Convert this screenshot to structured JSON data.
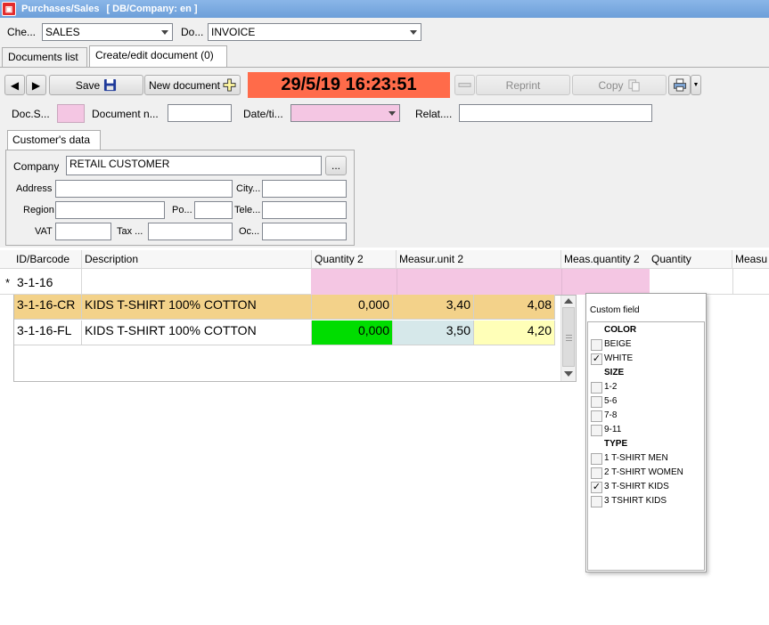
{
  "titlebar": {
    "app_title": "Purchases/Sales",
    "db_info": "[ DB/Company: en ]"
  },
  "top": {
    "che_label": "Che...",
    "che_value": "SALES",
    "do_label": "Do...",
    "do_value": "INVOICE"
  },
  "tabs": {
    "documents_list": "Documents list",
    "create_edit": "Create/edit document (0)"
  },
  "toolbar": {
    "save_label": "Save",
    "new_document_label": "New document",
    "datetime": "29/5/19 16:23:51",
    "reprint_label": "Reprint",
    "copy_label": "Copy",
    "datetime_bg": "#ff6b4a"
  },
  "docfields": {
    "doc_s_label": "Doc.S...",
    "document_n_label": "Document n...",
    "date_label": "Date/ti...",
    "relat_label": "Relat...."
  },
  "customer": {
    "tab_label": "Customer's data",
    "company_label": "Company",
    "company_value": "RETAIL CUSTOMER",
    "browse_label": "...",
    "address_label": "Address",
    "city_label": "City...",
    "region_label": "Region",
    "po_label": "Po...",
    "tele_label": "Tele...",
    "vat_label": "VAT",
    "tax_label": "Tax ...",
    "oc_label": "Oc..."
  },
  "grid": {
    "columns": [
      "ID/Barcode",
      "Description",
      "Quantity 2",
      "Measur.unit 2",
      "Meas.quantity 2",
      "Quantity",
      "Measu"
    ],
    "new_row_marker": "*",
    "new_row_id": "3-1-16",
    "rows": [
      {
        "id": "3-1-16-CR",
        "description": "KIDS T-SHIRT 100% COTTON",
        "qty2": "0,000",
        "unit2": "3,40",
        "mqty2": "4,08"
      },
      {
        "id": "3-1-16-FL",
        "description": "KIDS T-SHIRT 100% COTTON",
        "qty2": "0,000",
        "unit2": "3,50",
        "mqty2": "4,20"
      }
    ]
  },
  "custom_field": {
    "title": "Custom field",
    "items": [
      {
        "label": "COLOR",
        "group": true
      },
      {
        "label": "BEIGE",
        "checked": false
      },
      {
        "label": "WHITE",
        "checked": true
      },
      {
        "label": "SIZE",
        "group": true
      },
      {
        "label": "1-2",
        "checked": false
      },
      {
        "label": "5-6",
        "checked": false
      },
      {
        "label": "7-8",
        "checked": false
      },
      {
        "label": "9-11",
        "checked": false
      },
      {
        "label": "TYPE",
        "group": true
      },
      {
        "label": "1 T-SHIRT MEN",
        "checked": false
      },
      {
        "label": "2 T-SHIRT WOMEN",
        "checked": false
      },
      {
        "label": "3 T-SHIRT KIDS",
        "checked": true
      },
      {
        "label": "3 TSHIRT KIDS",
        "checked": false
      }
    ]
  },
  "icons": [
    "app-icon",
    "nav-left-icon",
    "nav-right-icon",
    "floppy-disk-icon",
    "plus-icon",
    "minus-icon",
    "copy-icon",
    "printer-icon",
    "dropdown-arrow-icon"
  ],
  "colors": {
    "title_bar": "#6d9fd9",
    "pink_field": "#f4c6e3",
    "selected_row": "#f3d28a",
    "green_cell": "#00dd00",
    "blue_cell": "#d6e8ea",
    "yellow_cell": "#ffffb8"
  }
}
